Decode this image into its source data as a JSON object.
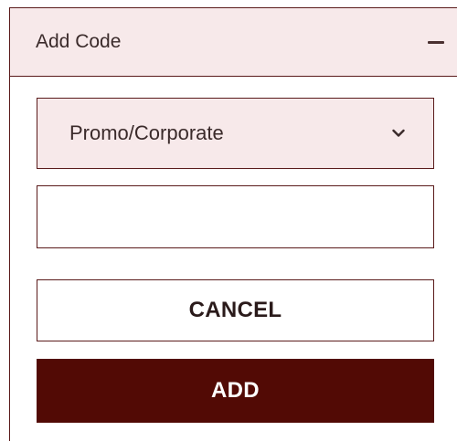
{
  "header": {
    "title": "Add Code",
    "collapse_icon": "minus-icon"
  },
  "code_type_select": {
    "selected": "Promo/Corporate",
    "icon": "chevron-down-icon"
  },
  "code_input": {
    "value": "",
    "placeholder": ""
  },
  "actions": {
    "cancel_label": "CANCEL",
    "add_label": "ADD"
  },
  "colors": {
    "accent": "#520a05",
    "header_bg": "#f7e9ea",
    "border": "#5a1a1a"
  }
}
